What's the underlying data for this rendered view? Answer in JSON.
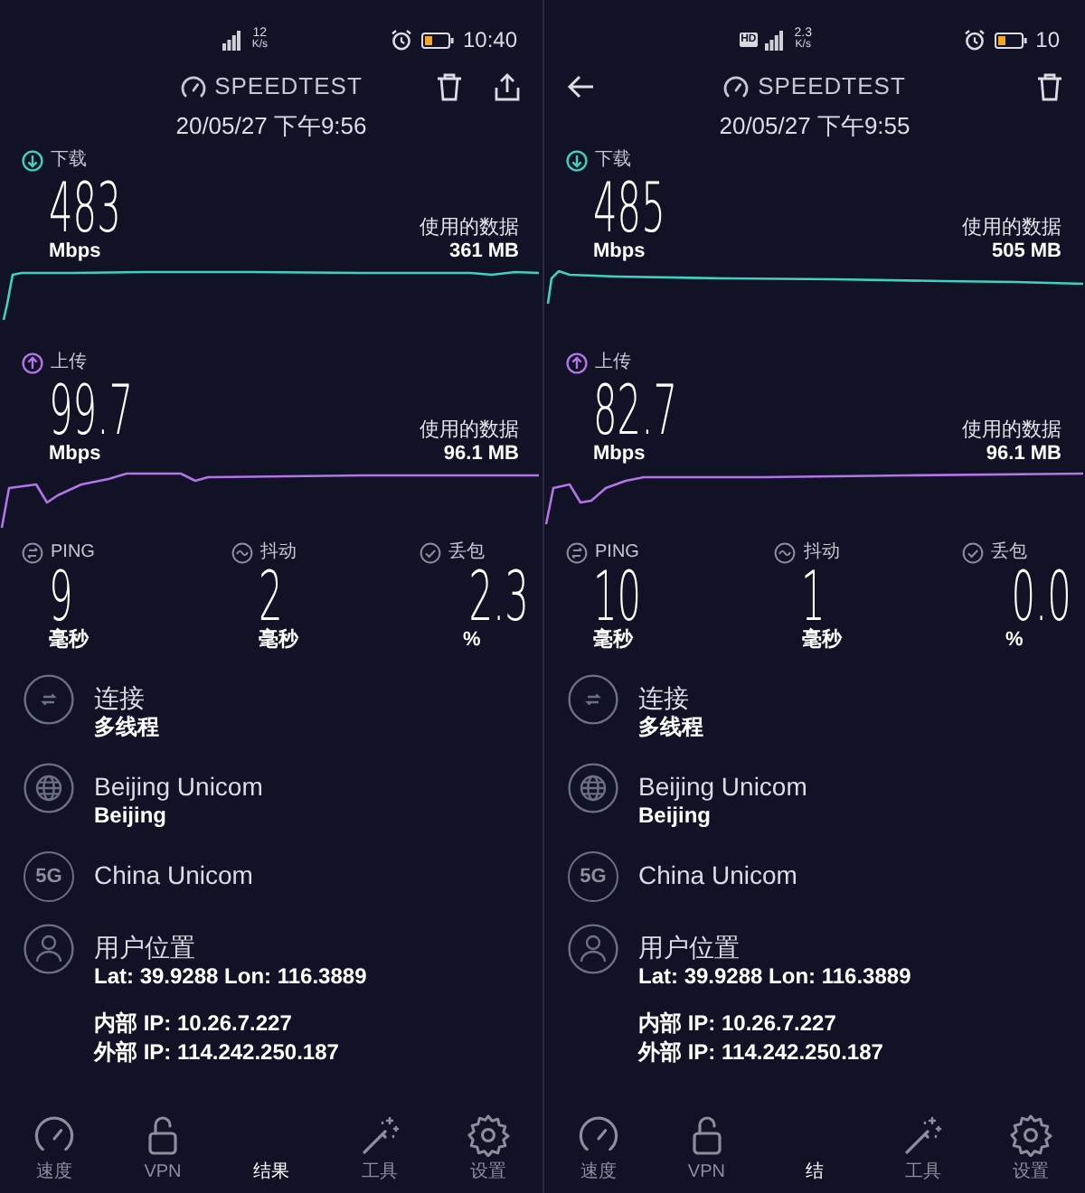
{
  "screens": [
    {
      "status_bar": {
        "net_speed": "12",
        "net_speed_unit": "K/s",
        "time": "10:40"
      },
      "header": {
        "buttons": [
          {
            "kind": "delete"
          },
          {
            "kind": "share"
          }
        ],
        "title": "SPEEDTEST",
        "timestamp": "20/05/27 下午9:56"
      },
      "download": {
        "label": "下载",
        "value": "483",
        "unit": "Mbps",
        "data_label": "使用的数据",
        "data_used": "361 MB"
      },
      "upload": {
        "label": "上传",
        "value": "99.7",
        "unit": "Mbps",
        "data_label": "使用的数据",
        "data_used": "96.1 MB"
      },
      "metrics": [
        {
          "kind": "ping",
          "label": "PING",
          "value": "9",
          "unit": "毫秒"
        },
        {
          "kind": "jitter",
          "label": "抖动",
          "value": "2",
          "unit": "毫秒"
        },
        {
          "kind": "loss",
          "label": "丢包",
          "value": "2.3",
          "unit": "%"
        }
      ],
      "details": [
        {
          "kind": "connection",
          "title": "连接",
          "subtitle": "多线程"
        },
        {
          "kind": "server",
          "title": "Beijing Unicom",
          "subtitle": "Beijing"
        },
        {
          "kind": "carrier",
          "icon_text": "5G",
          "title": "China Unicom"
        },
        {
          "kind": "location",
          "title": "用户位置",
          "subtitle": "Lat: 39.9288 Lon: 116.3889"
        }
      ],
      "ip_addresses": [
        "内部 IP: 10.26.7.227",
        "外部 IP: 114.242.250.187"
      ],
      "nav": [
        {
          "kind": "speed",
          "label": "速度",
          "selected": false
        },
        {
          "kind": "vpn",
          "label": "VPN",
          "selected": false
        },
        {
          "kind": "results",
          "label": "结果",
          "selected": true
        },
        {
          "kind": "tools",
          "label": "工具",
          "selected": false
        },
        {
          "kind": "settings",
          "label": "设置",
          "selected": false
        }
      ]
    },
    {
      "status_bar": {
        "badge": "HD",
        "net_speed": "2.3",
        "net_speed_unit": "K/s",
        "time": "10"
      },
      "header": {
        "buttons": [
          {
            "kind": "back"
          },
          {
            "kind": "delete"
          }
        ],
        "title": "SPEEDTEST",
        "timestamp": "20/05/27 下午9:55"
      },
      "download": {
        "label": "下载",
        "value": "485",
        "unit": "Mbps",
        "data_label": "使用的数据",
        "data_used": "505 MB"
      },
      "upload": {
        "label": "上传",
        "value": "82.7",
        "unit": "Mbps",
        "data_label": "使用的数据",
        "data_used": "96.1 MB"
      },
      "metrics": [
        {
          "kind": "ping",
          "label": "PING",
          "value": "10",
          "unit": "毫秒"
        },
        {
          "kind": "jitter",
          "label": "抖动",
          "value": "1",
          "unit": "毫秒"
        },
        {
          "kind": "loss",
          "label": "丢包",
          "value": "0.0",
          "unit": "%"
        }
      ],
      "details": [
        {
          "kind": "connection",
          "title": "连接",
          "subtitle": "多线程"
        },
        {
          "kind": "server",
          "title": "Beijing Unicom",
          "subtitle": "Beijing"
        },
        {
          "kind": "carrier",
          "icon_text": "5G",
          "title": "China Unicom"
        },
        {
          "kind": "location",
          "title": "用户位置",
          "subtitle": "Lat: 39.9288 Lon: 116.3889"
        }
      ],
      "ip_addresses": [
        "内部 IP: 10.26.7.227",
        "外部 IP: 114.242.250.187"
      ],
      "nav": [
        {
          "kind": "speed",
          "label": "速度",
          "selected": false
        },
        {
          "kind": "vpn",
          "label": "VPN",
          "selected": false
        },
        {
          "kind": "results",
          "label": "结",
          "selected": true
        },
        {
          "kind": "tools",
          "label": "工具",
          "selected": false
        },
        {
          "kind": "settings",
          "label": "设置",
          "selected": false
        }
      ]
    }
  ]
}
